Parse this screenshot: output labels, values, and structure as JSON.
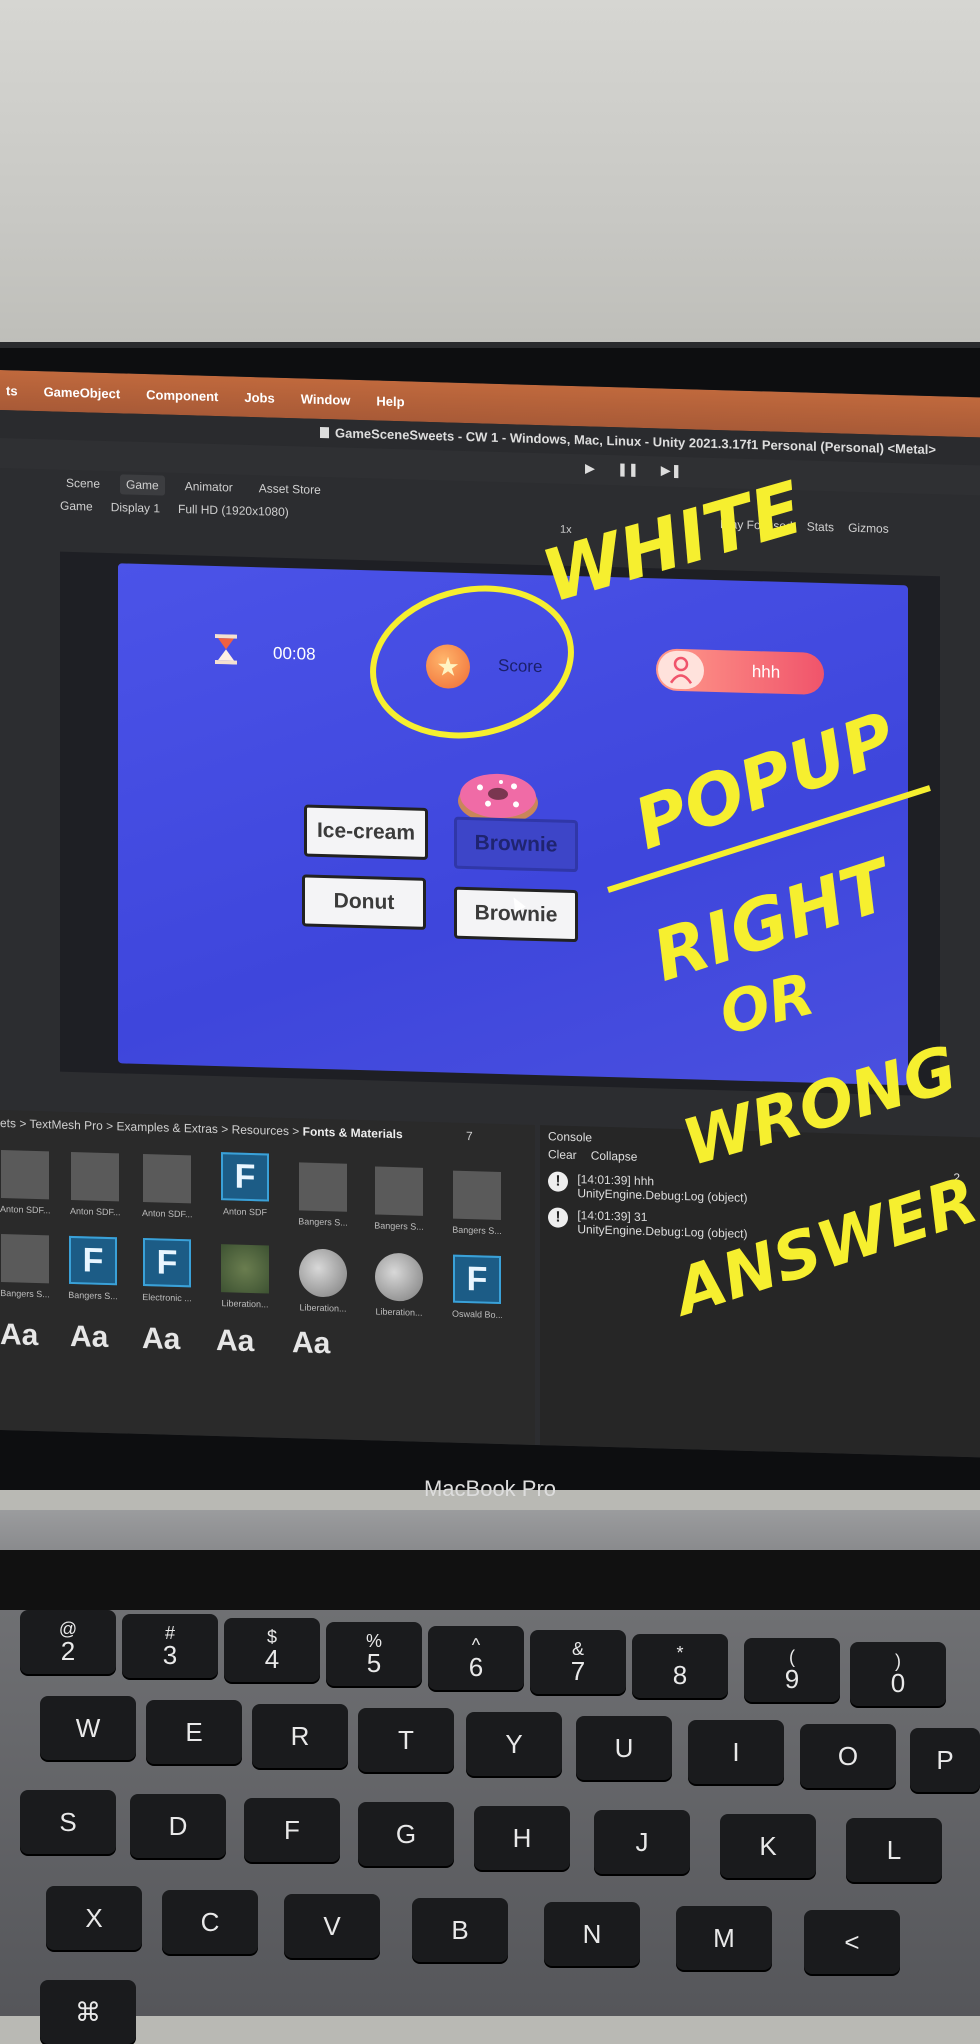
{
  "menu": [
    "ts",
    "GameObject",
    "Component",
    "Jobs",
    "Window",
    "Help"
  ],
  "window_title": "GameSceneSweets - CW 1 - Windows, Mac, Linux - Unity 2021.3.17f1 Personal (Personal) <Metal>",
  "play_controls": [
    "▶",
    "❚❚",
    "▶❚"
  ],
  "view_tabs": [
    "Scene",
    "Game",
    "Animator",
    "Asset Store"
  ],
  "game_bar": {
    "mode": "Game",
    "display": "Display 1",
    "resolution": "Full HD (1920x1080)",
    "scale": "1x"
  },
  "game_bar_right": [
    "Play Focused",
    "Stats",
    "Gizmos"
  ],
  "game": {
    "timer": "00:08",
    "score_label": "Score",
    "player_name": "hhh",
    "answers": [
      {
        "label": "Ice-cream",
        "selected": false
      },
      {
        "label": "Brownie",
        "selected": true
      },
      {
        "label": "Donut",
        "selected": false
      },
      {
        "label": "Brownie",
        "selected": false
      }
    ]
  },
  "project": {
    "breadcrumb": [
      "ets",
      "TextMesh Pro",
      "Examples & Extras",
      "Resources",
      "Fonts & Materials"
    ],
    "assets_row1": [
      "Anton SDF...",
      "Anton SDF...",
      "Anton SDF...",
      "Anton SDF",
      "Bangers S...",
      "Bangers S...",
      "Bangers S..."
    ],
    "assets_row2": [
      "Bangers S...",
      "Bangers S...",
      "Electronic ...",
      "Liberation...",
      "Liberation...",
      "Liberation...",
      "Oswald Bo..."
    ],
    "font_preview": "Aa",
    "hidden_count": "7"
  },
  "console": {
    "title": "Console",
    "buttons": [
      "Clear",
      "Collapse"
    ],
    "count": "2",
    "logs": [
      {
        "time": "[14:01:39] hhh",
        "detail": "UnityEngine.Debug:Log (object)"
      },
      {
        "time": "[14:01:39] 31",
        "detail": "UnityEngine.Debug:Log (object)"
      }
    ]
  },
  "laptop_brand": "MacBook Pro",
  "keys_row1": [
    [
      "@",
      "2"
    ],
    [
      "#",
      "3"
    ],
    [
      "$",
      "4"
    ],
    [
      "%",
      "5"
    ],
    [
      "^",
      "6"
    ],
    [
      "&",
      "7"
    ],
    [
      "*",
      "8"
    ],
    [
      "(",
      "9"
    ],
    [
      ")",
      "0"
    ]
  ],
  "keys_row2": [
    "W",
    "E",
    "R",
    "T",
    "Y",
    "U",
    "I",
    "O",
    "P"
  ],
  "keys_row3": [
    "S",
    "D",
    "F",
    "G",
    "H",
    "J",
    "K",
    "L"
  ],
  "keys_row4": [
    "X",
    "C",
    "V",
    "B",
    "N",
    "M",
    "<"
  ],
  "annotations": {
    "white": "WHITE",
    "popup": "POPUP",
    "right": "RIGHT",
    "or": "OR",
    "wrong": "WRONG",
    "answer": "ANSWER"
  },
  "colors": {
    "game_bg": "#3e46dc",
    "annotation": "#f6ef2f",
    "menubar": "#b35f39"
  }
}
